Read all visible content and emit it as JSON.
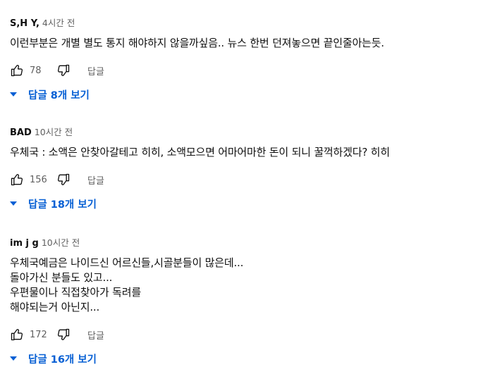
{
  "comments": [
    {
      "author": "S,H Y,",
      "time": "4시간 전",
      "text": [
        "이런부분은 개별 별도 통지 해야하지 않을까싶음.. 뉴스 한번 던져놓으면 끝인줄아는듯."
      ],
      "likes": "78",
      "reply_label": "답글",
      "replies_label": "답글 8개 보기"
    },
    {
      "author": "BAD",
      "time": "10시간 전",
      "text": [
        "우체국 : 소액은 안찾아갈테고 히히, 소액모으면 어마어마한 돈이 되니 꿀꺽하겠다? 히히"
      ],
      "likes": "156",
      "reply_label": "답글",
      "replies_label": "답글 18개 보기"
    },
    {
      "author": "im j g",
      "time": "10시간 전",
      "text": [
        "우체국예금은 나이드신 어르신들,시골분들이 많은데...",
        "돌아가신 분들도 있고...",
        "우편물이나 직접찾아가 독려를",
        "해야되는거 아닌지..."
      ],
      "likes": "172",
      "reply_label": "답글",
      "replies_label": "답글 16개 보기"
    }
  ],
  "icons": {
    "like": "thumbs-up-icon",
    "dislike": "thumbs-down-icon",
    "expand": "triangle-down-icon"
  },
  "colors": {
    "link": "#065fd4",
    "secondary": "#606060",
    "text": "#0f0f0f"
  }
}
